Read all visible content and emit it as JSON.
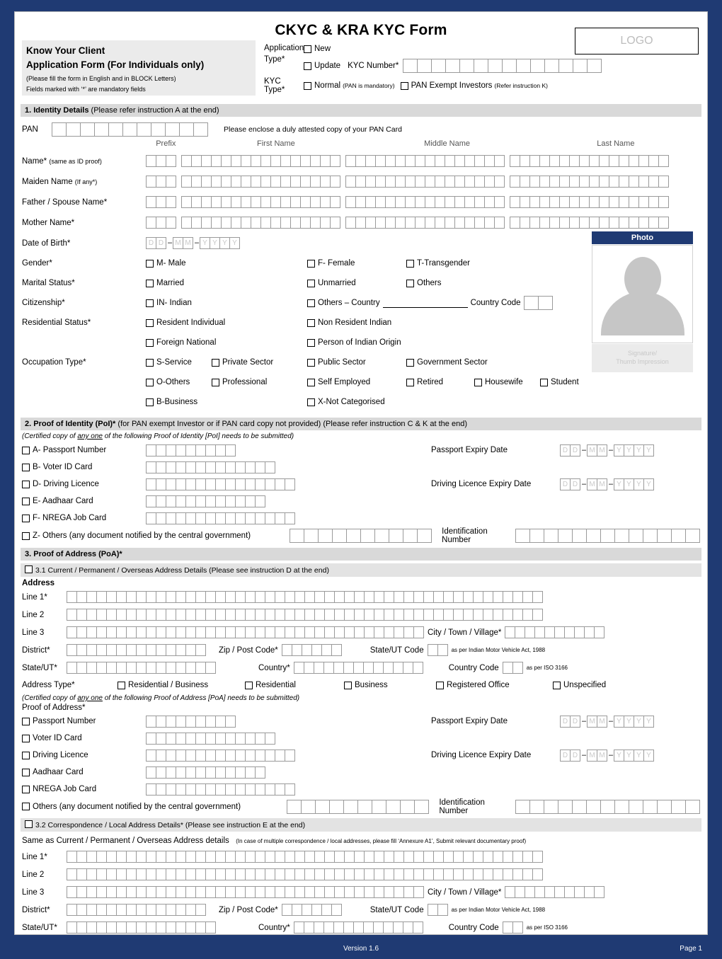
{
  "form": {
    "title": "CKYC & KRA KYC Form",
    "logo_placeholder": "LOGO",
    "heading_line1": "Know Your Client",
    "heading_line2": "Application Form (For Individuals only)",
    "note1": "(Please fill the form in English and in BLOCK Letters)",
    "note2": "Fields marked with ‘*’ are mandatory    fields",
    "application_type_label": "Application Type*",
    "opt_new": "New",
    "opt_update": "Update",
    "kyc_number_label": "KYC Number*",
    "kyc_number_cells": 14,
    "kyc_type_label": "KYC Type*",
    "opt_normal": "Normal",
    "opt_normal_note": "(PAN is mandatory)",
    "opt_pan_exempt": "PAN Exempt Investors",
    "opt_pan_exempt_note": "(Refer instruction K)"
  },
  "section1": {
    "header_bold": "1. Identity Details",
    "header_rest": "(Please refer instruction A at the end)",
    "pan_label": "PAN",
    "pan_cells": 11,
    "pan_note": "Please enclose a duly attested copy of your PAN Card",
    "name_columns": [
      "Prefix",
      "First Name",
      "Middle Name",
      "Last Name"
    ],
    "name_cells": [
      3,
      16,
      16,
      16
    ],
    "name_rows": [
      {
        "label": "Name*",
        "sub": "(same as ID proof)"
      },
      {
        "label": "Maiden Name",
        "sub": "(If any*)"
      },
      {
        "label": "Father / Spouse Name*",
        "sub": ""
      },
      {
        "label": "Mother Name*",
        "sub": ""
      }
    ],
    "dob_label": "Date of Birth*",
    "date_tokens": [
      "D",
      "D",
      "M",
      "M",
      "Y",
      "Y",
      "Y",
      "Y"
    ],
    "gender_label": "Gender*",
    "gender_options": [
      "M- Male",
      "F- Female",
      "T-Transgender"
    ],
    "marital_label": "Marital Status*",
    "marital_options": [
      "Married",
      "Unmarried",
      "Others"
    ],
    "citizenship_label": "Citizenship*",
    "citizenship_opt1": "IN- Indian",
    "citizenship_opt2": "Others – Country",
    "country_code_label": "Country Code",
    "residential_label": "Residential Status*",
    "residential_options": [
      "Resident Individual",
      "Non Resident Indian",
      "Foreign National",
      "Person of Indian Origin"
    ],
    "occupation_label": "Occupation Type*",
    "occupation_row1": [
      "S-Service",
      "Private Sector",
      "Public Sector",
      "Government Sector"
    ],
    "occupation_row2": [
      "O-Others",
      "Professional",
      "Self Employed",
      "Retired",
      "Housewife",
      "Student"
    ],
    "occupation_row3": [
      "B-Business",
      "X-Not Categorised"
    ],
    "photo_label": "Photo",
    "signature_label_l1": "Signature/",
    "signature_label_l2": "Thumb Impression"
  },
  "section2": {
    "header_bold": "2. Proof of Identity (PoI)*",
    "header_rest": "(for PAN exempt Investor or if PAN card copy not provided) (Please refer instruction C & K at the end)",
    "note_pre": "(Certified copy of ",
    "note_u": "any one",
    "note_post": " of the following Proof of Identity [PoI] needs to be submitted)",
    "docs": [
      {
        "label": "A- Passport Number",
        "cells": 9
      },
      {
        "label": "B- Voter ID Card",
        "cells": 13
      },
      {
        "label": "D- Driving Licence",
        "cells": 15
      },
      {
        "label": "E- Aadhaar Card",
        "cells": 12
      },
      {
        "label": "F- NREGA Job Card",
        "cells": 15
      }
    ],
    "passport_expiry_label": "Passport Expiry Date",
    "dl_expiry_label": "Driving Licence Expiry Date",
    "others_label": "Z- Others (any document notified by the central government)",
    "others_cells": 10,
    "ident_number_label": "Identification Number",
    "ident_number_cells": 13
  },
  "section3": {
    "header_bold": "3. Proof of Address (PoA)*",
    "sub31": "3.1 Current / Permanent / Overseas Address Details (Please see instruction D at the end)",
    "address_label": "Address",
    "line1_label": "Line 1*",
    "line2_label": "Line 2",
    "line3_label": "Line 3",
    "line_cells": 48,
    "line3_cells": 36,
    "city_label": "City / Town / Village*",
    "city_cells": 10,
    "district_label": "District*",
    "district_cells": 14,
    "zip_label": "Zip / Post Code*",
    "zip_cells": 6,
    "state_code_label": "State/UT Code",
    "state_code_cells": 2,
    "state_code_note": "as per Indian Motor Vehicle Act, 1988",
    "state_label": "State/UT*",
    "state_cells": 15,
    "country_label": "Country*",
    "country_cells": 13,
    "country_code_label": "Country Code",
    "country_code_cells": 2,
    "country_code_note": "as per ISO 3166",
    "address_type_label": "Address Type*",
    "address_type_options": [
      "Residential / Business",
      "Residential",
      "Business",
      "Registered Office",
      "Unspecified"
    ],
    "poa_note_pre": "(Certified copy of ",
    "poa_note_u": "any one",
    "poa_note_post": " of the following Proof of Address [PoA] needs to be submitted)",
    "poa_label": "Proof of Address*",
    "poa_docs": [
      {
        "label": "Passport Number",
        "cells": 9
      },
      {
        "label": "Voter ID Card",
        "cells": 13
      },
      {
        "label": "Driving Licence",
        "cells": 15
      },
      {
        "label": "Aadhaar Card",
        "cells": 12
      },
      {
        "label": "NREGA Job Card",
        "cells": 15
      }
    ],
    "poa_others_label": "Others (any document notified by the central government)",
    "sub32": "3.2 Correspondence / Local Address Details* (Please see instruction E at the end)",
    "same_as_label": "Same as Current / Permanent / Overseas Address details",
    "same_as_note": "(In case of multiple correspondence / local addresses, please fill ‘Annexure A1’, Submit relevant documentary proof)"
  },
  "footer": {
    "version": "Version 1.6",
    "page": "Page 1"
  }
}
